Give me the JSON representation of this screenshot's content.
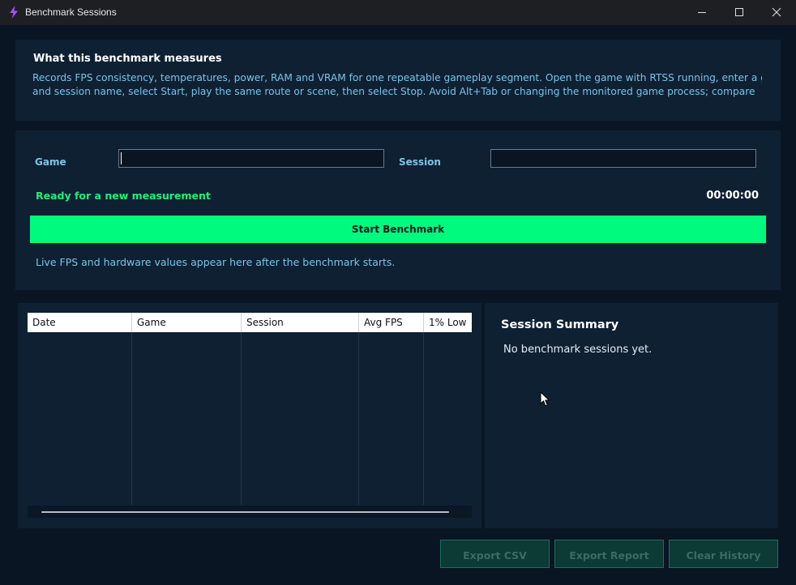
{
  "window": {
    "title": "Benchmark Sessions",
    "icon": "lightning-bolt-icon",
    "controls": [
      "minimize-icon",
      "maximize-icon",
      "close-icon"
    ]
  },
  "info": {
    "heading": "What this benchmark measures",
    "line1": "Records FPS consistency, temperatures, power, RAM and VRAM for one repeatable gameplay segment. Open the game with RTSS running, enter a game",
    "line2": "and session name, select Start, play the same route or scene, then select Stop. Avoid Alt+Tab or changing the monitored game process; compare"
  },
  "form": {
    "game_label": "Game",
    "game_value": "",
    "session_label": "Session",
    "session_value": ""
  },
  "status": {
    "text": "Ready for a new measurement",
    "timer": "00:00:00"
  },
  "start_button": "Start Benchmark",
  "live_hint": "Live FPS and hardware values appear here after the benchmark starts.",
  "table": {
    "columns": [
      "Date",
      "Game",
      "Session",
      "Avg FPS",
      "1% Low"
    ],
    "rows": []
  },
  "summary": {
    "title": "Session Summary",
    "text": "No benchmark sessions yet."
  },
  "actions": {
    "export_csv": "Export CSV",
    "export_report": "Export Report",
    "clear_history": "Clear History"
  },
  "colors": {
    "accent_green": "#00fa7d",
    "status_green": "#22ee7a",
    "info_blue": "#79c4e6",
    "panel_bg": "#0f2033",
    "window_bg": "#0a1523"
  }
}
